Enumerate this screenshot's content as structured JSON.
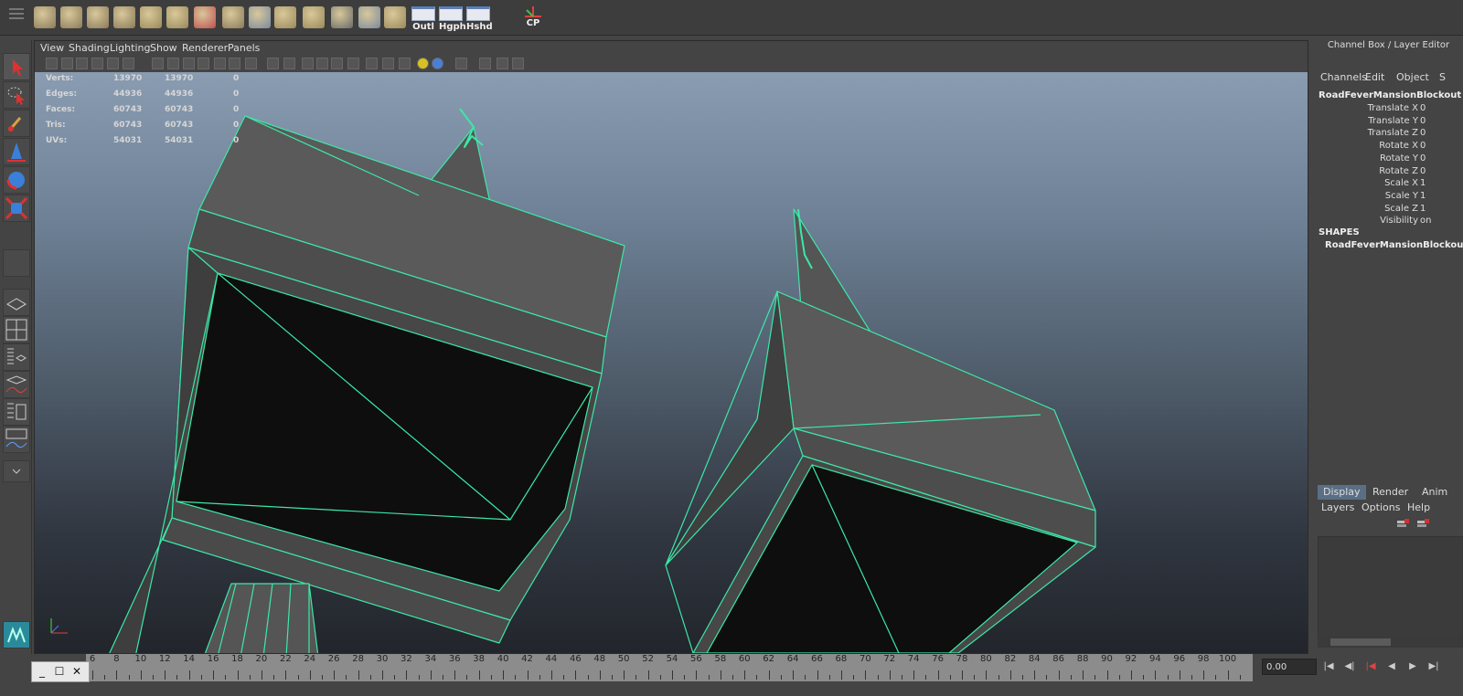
{
  "shelf": {
    "items": [
      {
        "name": "poly-cube-icon",
        "text": ""
      },
      {
        "name": "poly-sphere-icon",
        "text": ""
      },
      {
        "name": "poly-cylinder-icon",
        "text": ""
      },
      {
        "name": "poly-pipe-icon",
        "text": ""
      },
      {
        "name": "poly-plane-icon",
        "text": ""
      },
      {
        "name": "poly-extrude-icon",
        "text": ""
      },
      {
        "name": "poly-cone-icon",
        "text": ""
      },
      {
        "name": "bevel-icon",
        "text": ""
      },
      {
        "name": "bridge-icon",
        "text": ""
      },
      {
        "name": "append-polygon-icon",
        "text": ""
      },
      {
        "name": "split-polygon-icon",
        "text": ""
      },
      {
        "name": "soccer-ball-icon",
        "text": ""
      },
      {
        "name": "merge-icon",
        "text": ""
      },
      {
        "name": "uv-layout-icon",
        "text": ""
      },
      {
        "name": "outliner-button",
        "text": "Outl"
      },
      {
        "name": "hypergraph-button",
        "text": "Hgph"
      },
      {
        "name": "hypershade-button",
        "text": "Hshd"
      },
      {
        "name": "center-pivot-button",
        "text": "CP"
      }
    ]
  },
  "viewport": {
    "menus": [
      "View",
      "Shading",
      "Lighting",
      "Show",
      "Renderer",
      "Panels"
    ],
    "hud": [
      {
        "label": "Verts:",
        "a": "13970",
        "b": "13970",
        "c": "0"
      },
      {
        "label": "Edges:",
        "a": "44936",
        "b": "44936",
        "c": "0"
      },
      {
        "label": "Faces:",
        "a": "60743",
        "b": "60743",
        "c": "0"
      },
      {
        "label": "Tris:",
        "a": "60743",
        "b": "60743",
        "c": "0"
      },
      {
        "label": "UVs:",
        "a": "54031",
        "b": "54031",
        "c": "0"
      }
    ],
    "axis_label": "x y z"
  },
  "channel_box": {
    "title": "Channel Box / Layer Editor",
    "tabs": [
      "Channels",
      "Edit",
      "Object",
      "S"
    ],
    "object_name": "RoadFeverMansionBlockout",
    "attributes": [
      {
        "label": "Translate X",
        "value": "0"
      },
      {
        "label": "Translate Y",
        "value": "0"
      },
      {
        "label": "Translate Z",
        "value": "0"
      },
      {
        "label": "Rotate X",
        "value": "0"
      },
      {
        "label": "Rotate Y",
        "value": "0"
      },
      {
        "label": "Rotate Z",
        "value": "0"
      },
      {
        "label": "Scale X",
        "value": "1"
      },
      {
        "label": "Scale Y",
        "value": "1"
      },
      {
        "label": "Scale Z",
        "value": "1"
      },
      {
        "label": "Visibility",
        "value": "on"
      }
    ],
    "shapes_header": "SHAPES",
    "shape_name": "RoadFeverMansionBlockoutShape"
  },
  "layer_editor": {
    "tabs": [
      "Display",
      "Render",
      "Anim"
    ],
    "menus": [
      "Layers",
      "Options",
      "Help"
    ]
  },
  "timeline": {
    "ticks": [
      "6",
      "8",
      "10",
      "12",
      "14",
      "16",
      "18",
      "20",
      "22",
      "24",
      "26",
      "28",
      "30",
      "32",
      "34",
      "36",
      "38",
      "40",
      "42",
      "44",
      "46",
      "48",
      "50",
      "52",
      "54",
      "56",
      "58",
      "60",
      "62",
      "64",
      "66",
      "68",
      "70",
      "72",
      "74",
      "76",
      "78",
      "80",
      "82",
      "84",
      "86",
      "88",
      "90",
      "92",
      "94",
      "96",
      "98",
      "100"
    ],
    "current_frame": "0.00"
  },
  "colors": {
    "wireframe": "#3ce8a8",
    "model_fill": "#575757",
    "dark_face": "#0f0f0f",
    "accent_tab": "#5a6f86"
  }
}
